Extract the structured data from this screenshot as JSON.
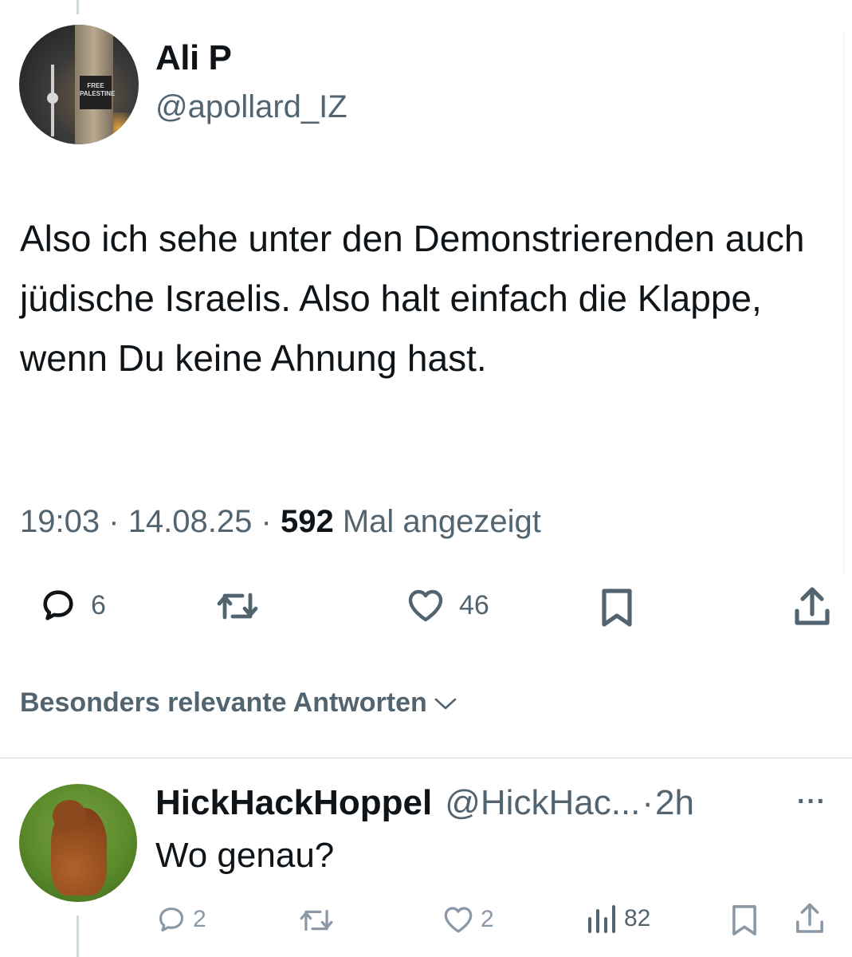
{
  "tweet": {
    "author_name": "Ali P",
    "author_handle": "@apollard_IZ",
    "avatar_sticker_text": "FREE PALESTINE",
    "text": "Also ich sehe unter den Demonstrierenden auch jüdische Israelis. Also halt einfach die Klappe, wenn Du keine Ahnung hast.",
    "time": "19:03",
    "separator": "·",
    "date": "14.08.25",
    "views_count": "592",
    "views_label": "Mal angezeigt",
    "actions": {
      "reply_icon": "reply-bubble-icon",
      "reply_count": "6",
      "retweet_icon": "retweet-icon",
      "like_icon": "heart-icon",
      "like_count": "46",
      "bookmark_icon": "bookmark-icon",
      "share_icon": "share-icon"
    }
  },
  "replies_sort": {
    "label": "Besonders relevante Antworten",
    "icon": "chevron-down-icon"
  },
  "reply": {
    "author_name": "HickHackHoppel",
    "author_handle": "@HickHac...",
    "separator": "·",
    "time_ago": "2h",
    "more_label": "···",
    "text": "Wo genau?",
    "actions": {
      "reply_count": "2",
      "like_count": "2",
      "views_count": "82"
    }
  },
  "colors": {
    "text_primary": "#0f1419",
    "text_secondary": "#536471",
    "icon_muted": "#8b98a5",
    "divider": "#cfd9de"
  }
}
